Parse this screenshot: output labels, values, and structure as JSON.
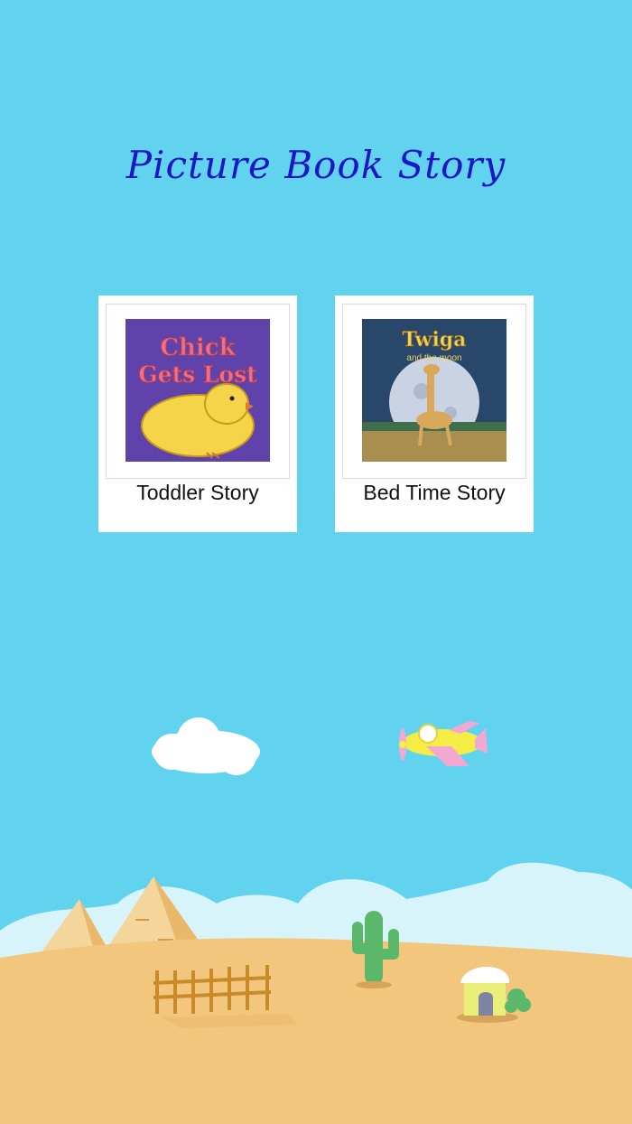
{
  "app": {
    "title": "Picture Book Story"
  },
  "books": [
    {
      "label": "Toddler Story",
      "cover_line1": "Chick",
      "cover_line2": "Gets Lost",
      "cover_color": "#5b3fa6"
    },
    {
      "label": "Bed Time Story",
      "cover_line1": "Twiga",
      "cover_line2": "and the moon",
      "cover_color": "#28476a"
    }
  ],
  "colors": {
    "sky": "#62d3ef",
    "title": "#1b17c6",
    "sand": "#f3c67d"
  },
  "icons": [
    "cloud-icon",
    "airplane-icon",
    "pyramid-icon",
    "cactus-icon",
    "fence-icon",
    "hut-icon",
    "bush-icon"
  ]
}
